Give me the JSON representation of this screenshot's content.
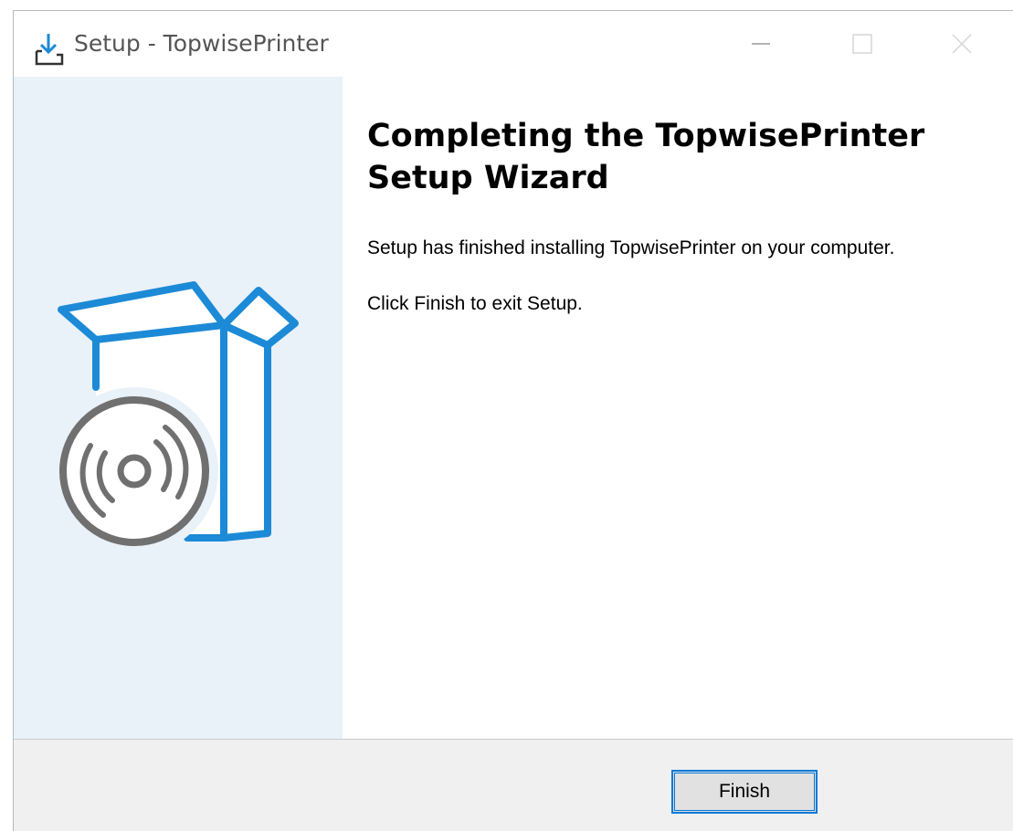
{
  "window": {
    "title": "Setup - TopwisePrinter",
    "icon": "setup-download-icon",
    "controls": [
      "minimize-icon",
      "maximize-icon",
      "close-icon"
    ]
  },
  "side_panel": {
    "image": "software-box-disc-icon",
    "colors": {
      "background": "#e9f1f9",
      "box": "#1c8ad6",
      "disc": "#707070"
    }
  },
  "main": {
    "heading": "Completing the TopwisePrinter Setup Wizard",
    "paragraph_1": "Setup has finished installing TopwisePrinter on your computer.",
    "paragraph_2": "Click Finish to exit Setup."
  },
  "footer": {
    "finish_label": "Finish",
    "accent": "#0078d7"
  }
}
